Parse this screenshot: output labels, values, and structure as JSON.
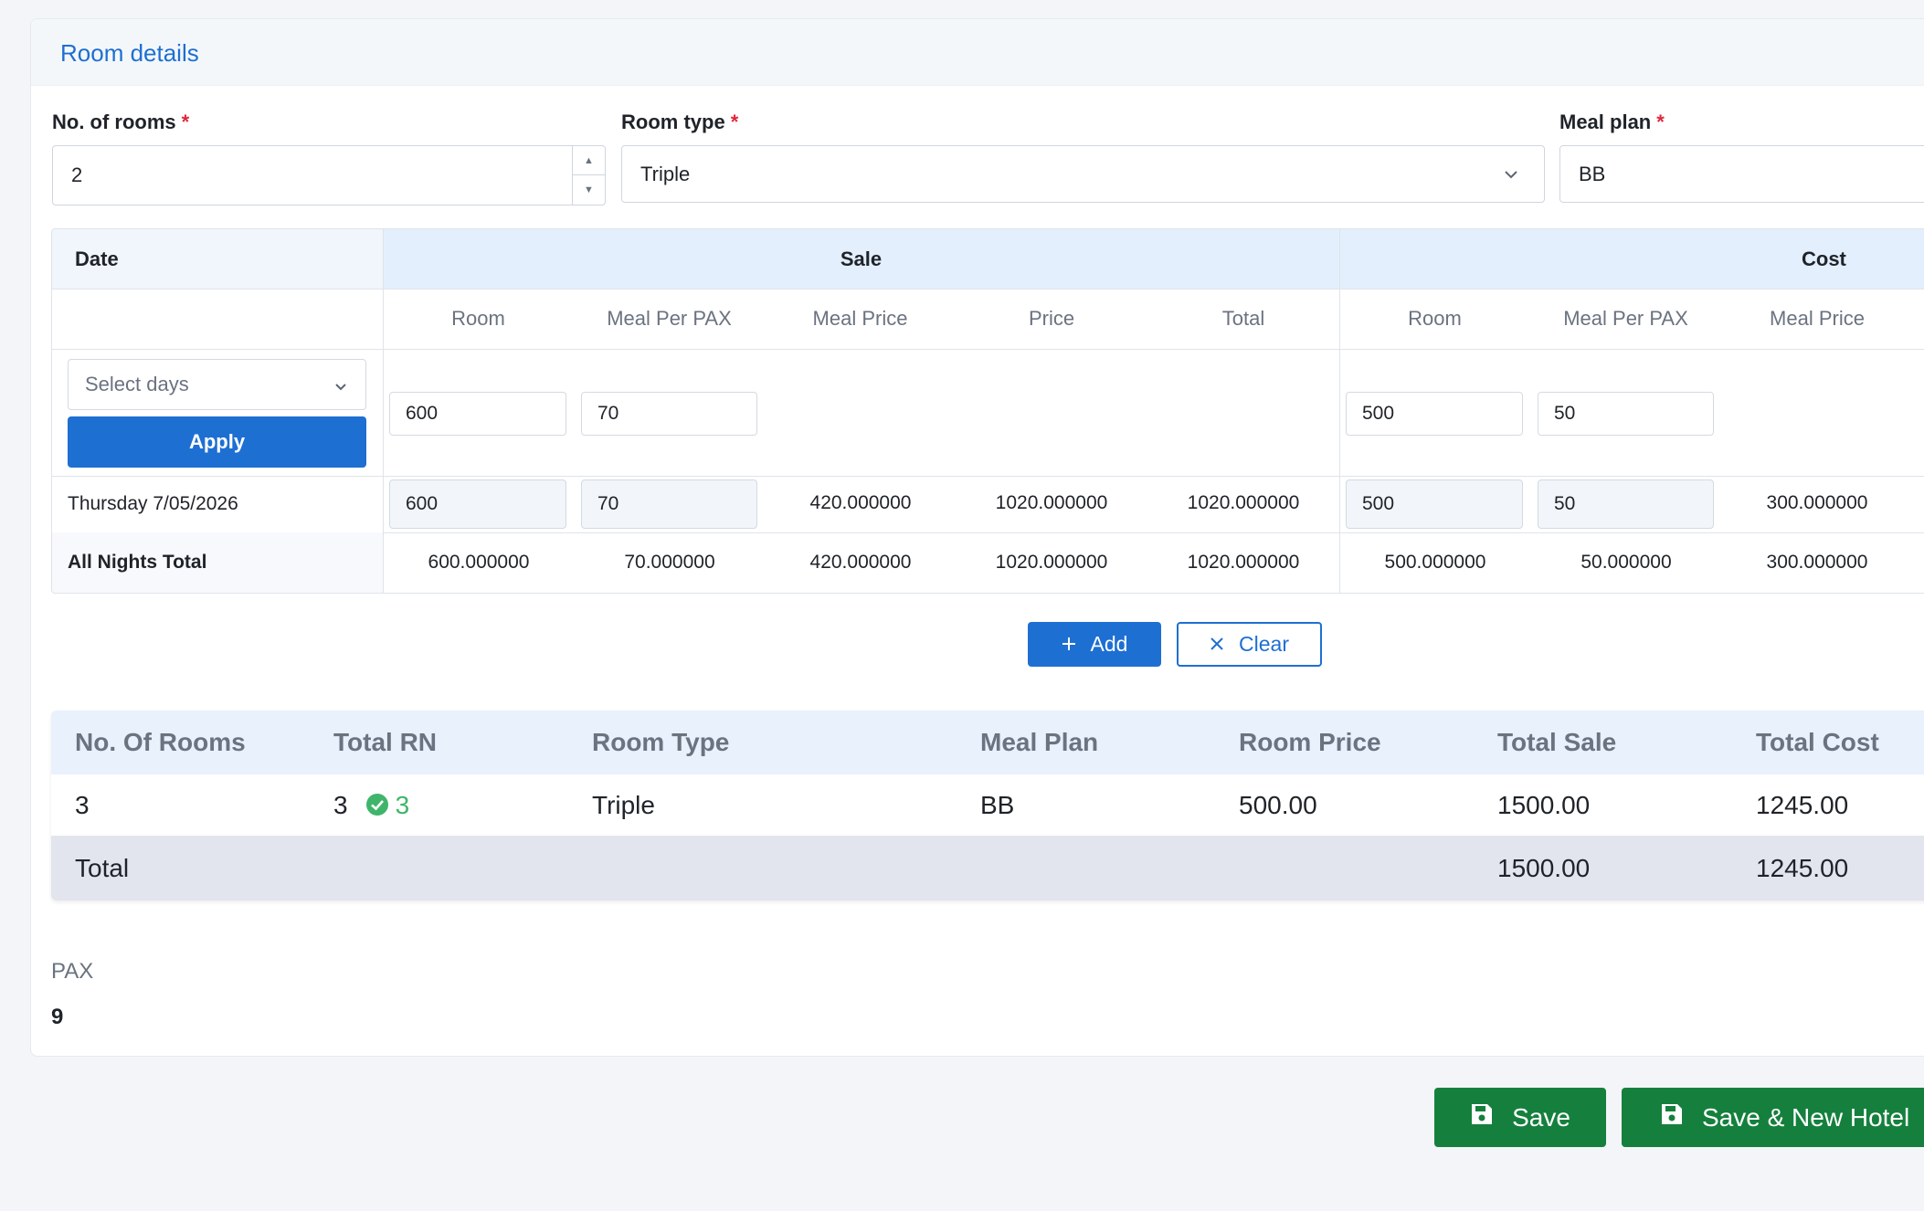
{
  "card": {
    "title": "Room details"
  },
  "form": {
    "rooms_label": "No. of rooms",
    "rooms_value": "2",
    "room_type_label": "Room type",
    "room_type_value": "Triple",
    "meal_plan_label": "Meal plan",
    "meal_plan_value": "BB",
    "required_mark": "*"
  },
  "grid": {
    "date_header": "Date",
    "sale_header": "Sale",
    "cost_header": "Cost",
    "sale_cols": [
      "Room",
      "Meal Per PAX",
      "Meal Price",
      "Price",
      "Total"
    ],
    "cost_cols": [
      "Room",
      "Meal Per PAX",
      "Meal Price"
    ],
    "select_days_placeholder": "Select days",
    "apply_label": "Apply",
    "bulk": {
      "sale_room": "600",
      "sale_meal": "70",
      "cost_room": "500",
      "cost_meal": "50"
    },
    "row": {
      "date": "Thursday 7/05/2026",
      "sale_room": "600",
      "sale_meal": "70",
      "sale_meal_price": "420.000000",
      "sale_price": "1020.000000",
      "sale_total": "1020.000000",
      "cost_room": "500",
      "cost_meal": "50",
      "cost_meal_price": "300.000000"
    },
    "totals": {
      "label": "All Nights Total",
      "sale_room": "600.000000",
      "sale_meal": "70.000000",
      "sale_meal_price": "420.000000",
      "sale_price": "1020.000000",
      "sale_total": "1020.000000",
      "cost_room": "500.000000",
      "cost_meal": "50.000000",
      "cost_meal_price": "300.000000"
    }
  },
  "actions": {
    "add": "Add",
    "clear": "Clear"
  },
  "summary": {
    "headers": [
      "No. Of Rooms",
      "Total RN",
      "Room Type",
      "Meal Plan",
      "Room Price",
      "Total Sale",
      "Total Cost"
    ],
    "row": {
      "rooms": "3",
      "total_rn": "3",
      "rn_ok": "3",
      "room_type": "Triple",
      "meal_plan": "BB",
      "room_price": "500.00",
      "total_sale": "1500.00",
      "total_cost": "1245.00"
    },
    "total": {
      "label": "Total",
      "total_sale": "1500.00",
      "total_cost": "1245.00"
    }
  },
  "pax": {
    "label": "PAX",
    "value": "9"
  },
  "footer": {
    "save": "Save",
    "save_new": "Save & New Hotel"
  },
  "colors": {
    "primary": "#1e6fd2",
    "success": "#15803d",
    "check": "#3fb56b",
    "required": "#e0263e"
  },
  "icons": [
    "chevron-down-icon",
    "spin-up-icon",
    "spin-down-icon",
    "plus-icon",
    "close-icon",
    "check-circle-icon",
    "floppy-disk-icon"
  ]
}
